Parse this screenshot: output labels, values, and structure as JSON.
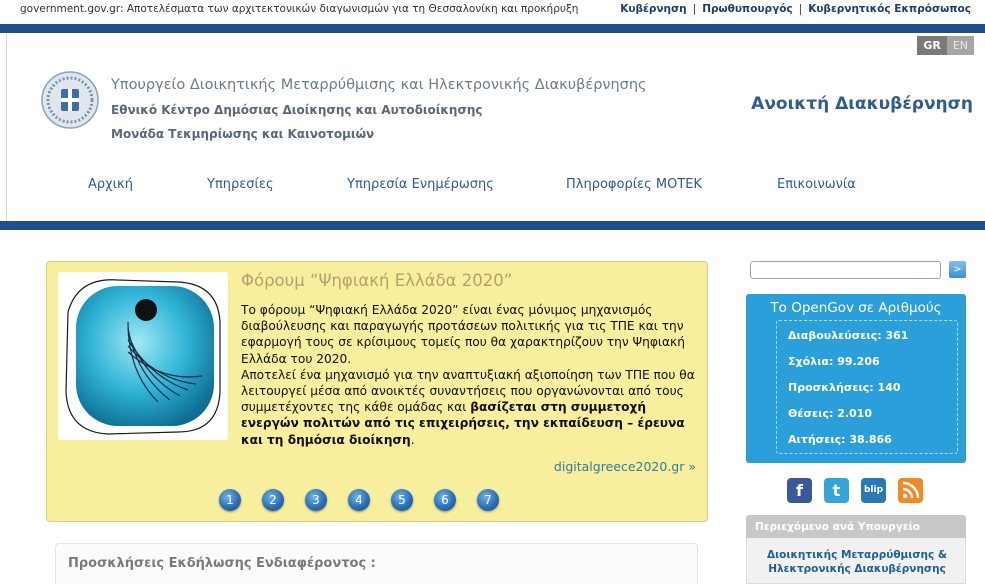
{
  "topbar": {
    "crumb": "government.gov.gr: Αποτελέσματα των αρχιτεκτονικών διαγωνισμών για τη Θεσσαλονίκη και προκήρυξη",
    "links": [
      "Κυβέρνηση",
      "Πρωθυπουργός",
      "Κυβερνητικός Εκπρόσωπος"
    ]
  },
  "lang": {
    "gr": "GR",
    "en": "EN"
  },
  "header": {
    "ministry": "Υπουργείο Διοικητικής Μεταρρύθμισης και Ηλεκτρονικής Διακυβέρνησης",
    "sub1": "Εθνικό Κέντρο Δημόσιας Διοίκησης και Αυτοδιοίκησης",
    "sub2": "Μονάδα Τεκμηρίωσης και Καινοτομιών",
    "opengov": "Ανοικτή Διακυβέρνηση"
  },
  "nav": [
    "Αρχική",
    "Υπηρεσίες",
    "Υπηρεσία Ενημέρωσης",
    "Πληροφορίες ΜΟΤΕΚ",
    "Επικοινωνία"
  ],
  "feature": {
    "title": "Φόρουμ “Ψηφιακή Ελλάδα 2020”",
    "p1": "Το φόρουμ “Ψηφιακή Ελλάδα 2020” είναι ένας μόνιμος μηχανισμός διαβούλευσης και παραγωγής προτάσεων πολιτικής για τις ΤΠΕ και την εφαρμογή τους σε κρίσιμους τομείς που θα χαρακτηρίζουν την Ψηφιακή Ελλάδα του 2020.",
    "p2": "Αποτελεί ένα μηχανισμό για την αναπτυξιακή αξιοποίηση των ΤΠΕ που θα λειτουργεί μέσα από ανοικτές συναντήσεις που οργανώνονται από τους συμμετέχοντες της κάθε ομάδας και",
    "p2_bold": "βασίζεται στη συμμετοχή ενεργών πολιτών από τις επιχειρήσεις, την εκπαίδευση – έρευνα και τη δημόσια διοίκηση",
    "p2_end": ".",
    "more": "digitalgreece2020.gr »",
    "pages": [
      "1",
      "2",
      "3",
      "4",
      "5",
      "6",
      "7"
    ]
  },
  "calls": {
    "title": "Προσκλήσεις Εκδήλωσης Ενδιαφέροντος :"
  },
  "search": {
    "button": ">"
  },
  "stats": {
    "title": "Το OpenGov σε Αριθμούς",
    "rows": [
      "Διαβουλεύσεις: 361",
      "Σχόλια: 99.206",
      "Προσκλήσεις: 140",
      "Θέσεις: 2.010",
      "Αιτήσεις: 38.866"
    ]
  },
  "social": [
    "facebook-icon",
    "twitter-icon",
    "blip-icon",
    "rss-icon"
  ],
  "panel": {
    "title": "Περιεχόμενο ανά Υπουργείο",
    "item_line1": "Διοικητικής Μεταρρύθμισης &",
    "item_line2": "Ηλεκτρονικής Διακυβέρνησης"
  }
}
